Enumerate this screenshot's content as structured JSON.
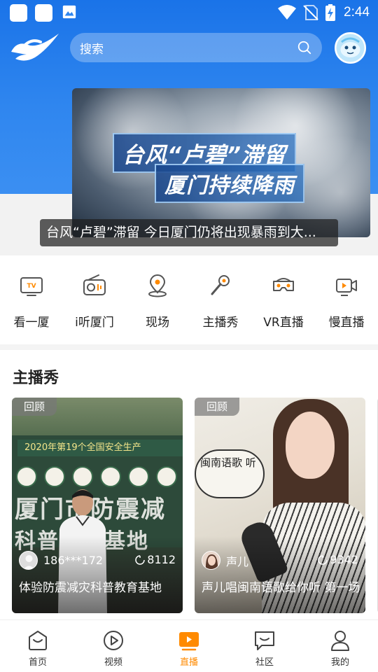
{
  "status_bar": {
    "time": "2:44"
  },
  "search": {
    "placeholder": "搜索"
  },
  "banner": {
    "headline_1": "台风“卢碧”滞留",
    "headline_2": "厦门持续降雨",
    "caption": "台风“卢碧”滞留 今日厦门仍将出现暴雨到大..."
  },
  "quick_nav": [
    {
      "label": "看一厦",
      "icon": "tv-icon"
    },
    {
      "label": "i听厦门",
      "icon": "radio-icon"
    },
    {
      "label": "现场",
      "icon": "location-icon"
    },
    {
      "label": "主播秀",
      "icon": "microphone-icon"
    },
    {
      "label": "VR直播",
      "icon": "vr-headset-icon"
    },
    {
      "label": "慢直播",
      "icon": "video-camera-icon"
    }
  ],
  "section": {
    "title": "主播秀",
    "cards": [
      {
        "badge": "回顾",
        "user": "186***172",
        "views": "8112",
        "title": "体验防震减灾科普教育基地",
        "scene_text": {
          "top": "2020年第19个全国安全生产",
          "line1": "厦门市防震减",
          "line2": "科普教育基地"
        }
      },
      {
        "badge": "回顾",
        "user": "声儿",
        "views": "9342",
        "title": "声儿唱闽南语歌给你听 第一场",
        "scene_text": {
          "bubble": "闽南语歌 听"
        }
      }
    ]
  },
  "tabs": [
    {
      "label": "首页",
      "icon": "home-icon",
      "active": false
    },
    {
      "label": "视频",
      "icon": "play-icon",
      "active": false
    },
    {
      "label": "直播",
      "icon": "live-icon",
      "active": true
    },
    {
      "label": "社区",
      "icon": "chat-icon",
      "active": false
    },
    {
      "label": "我的",
      "icon": "profile-icon",
      "active": false
    }
  ],
  "colors": {
    "header_blue": "#1a73e8",
    "active_tab": "#ff8a00",
    "icon_gray": "#555555"
  }
}
